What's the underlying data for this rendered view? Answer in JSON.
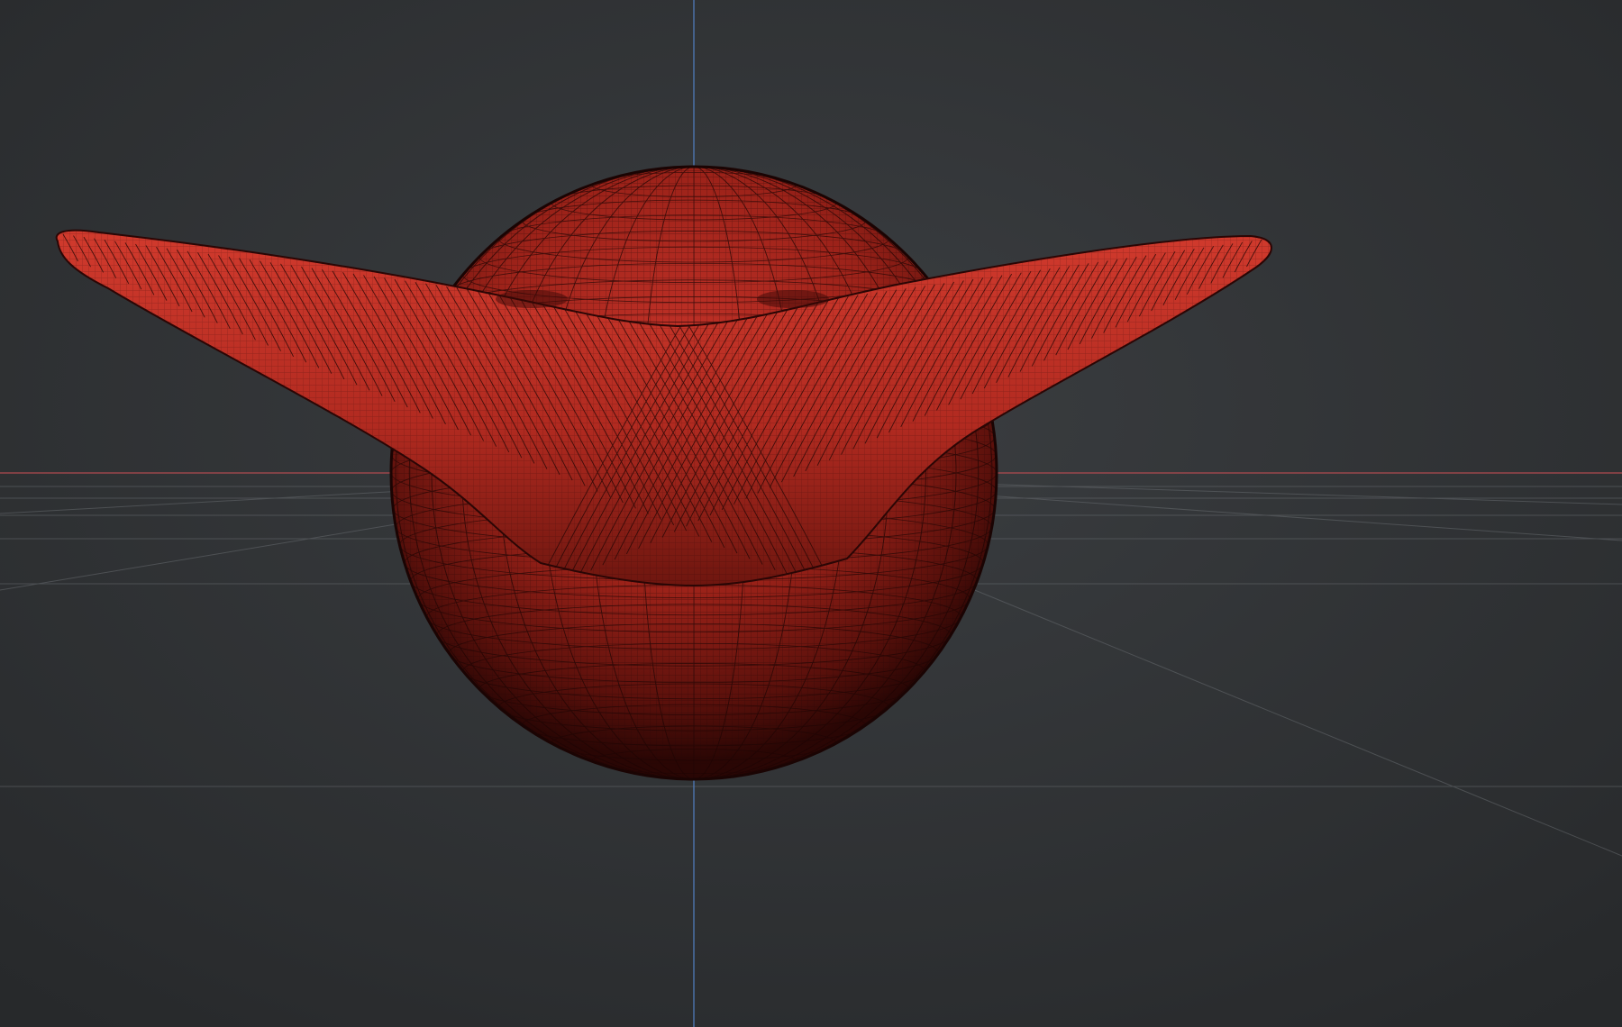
{
  "viewport": {
    "background_color": "#2e3134",
    "grid_color": "#5b5f63",
    "x_axis_color": "#b04a4f",
    "y_axis_color": "#4f7ab8",
    "object": {
      "shape": "sphere-with-horn-extrusions",
      "surface_color": "#b52a22",
      "wire_color": "#2a0a08",
      "shading": "wireframe-on-shaded"
    }
  }
}
